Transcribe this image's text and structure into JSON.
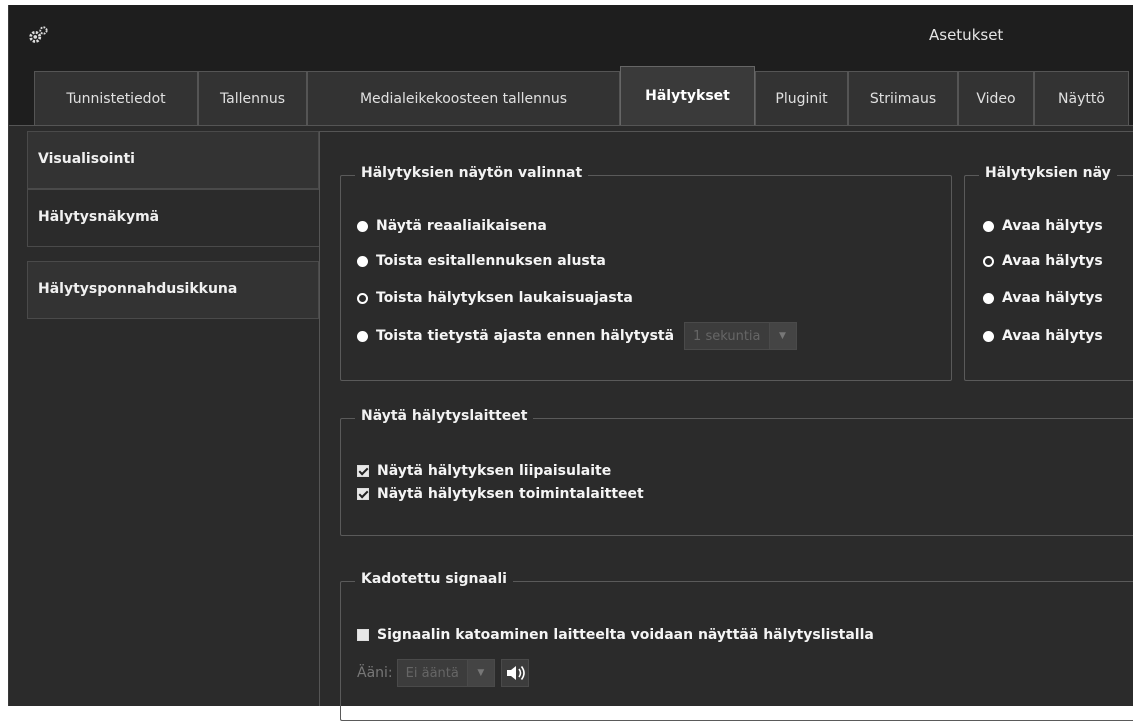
{
  "window": {
    "title": "Asetukset"
  },
  "tabs": [
    {
      "label": "Tunnistetiedot"
    },
    {
      "label": "Tallennus"
    },
    {
      "label": "Medialeikekoosteen tallennus"
    },
    {
      "label": "Hälytykset"
    },
    {
      "label": "Pluginit"
    },
    {
      "label": "Striimaus"
    },
    {
      "label": "Video"
    },
    {
      "label": "Näyttö"
    }
  ],
  "active_tab": "Hälytykset",
  "sidebar": {
    "items": [
      {
        "label": "Visualisointi"
      },
      {
        "label": "Hälytysnäkymä"
      },
      {
        "label": "Hälytysponnahdusikkuna"
      }
    ],
    "active": "Hälytysnäkymä"
  },
  "display_options": {
    "legend": "Hälytyksien näytön valinnat",
    "options": [
      {
        "label": "Näytä reaaliaikaisena",
        "selected": false
      },
      {
        "label": "Toista esitallennuksen alusta",
        "selected": false
      },
      {
        "label": "Toista hälytyksen laukaisuajasta",
        "selected": true
      },
      {
        "label": "Toista tietystä ajasta ennen hälytystä",
        "selected": false
      }
    ],
    "before_alarm_select": {
      "value": "1 sekuntia"
    }
  },
  "right_group": {
    "legend": "Hälytyksien näy",
    "options": [
      {
        "label": "Avaa hälytys",
        "selected": false
      },
      {
        "label": "Avaa hälytys",
        "selected": true
      },
      {
        "label": "Avaa hälytys",
        "selected": false
      },
      {
        "label": "Avaa hälytys",
        "selected": false
      }
    ]
  },
  "alarm_devices": {
    "legend": "Näytä hälytyslaitteet",
    "options": [
      {
        "label": "Näytä hälytyksen liipaisulaite",
        "checked": true
      },
      {
        "label": "Näytä hälytyksen toimintalaitteet",
        "checked": true
      }
    ]
  },
  "lost_signal": {
    "legend": "Kadotettu signaali",
    "checkbox_label": "Signaalin katoaminen laitteelta voidaan näyttää hälytyslistalla",
    "checked": false,
    "sound_label": "Ääni:",
    "sound_select": {
      "value": "Ei ääntä"
    }
  }
}
